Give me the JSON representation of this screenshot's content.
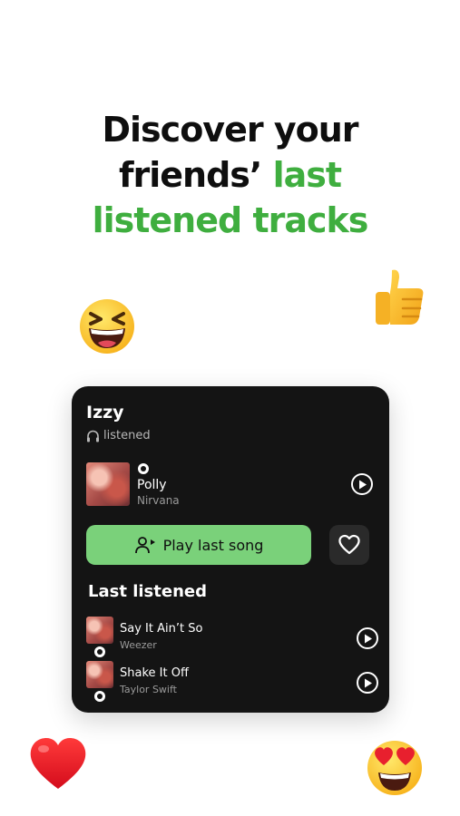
{
  "headline": {
    "line1": "Discover your",
    "line2_plain": "friends’",
    "line2_accent": "last",
    "line3_accent": "listened tracks"
  },
  "emojis": {
    "top_left": "grinning-squinting-face",
    "top_right": "thumbs-up",
    "bottom_left": "red-heart",
    "bottom_right": "heart-eyes-face"
  },
  "card": {
    "friend_name": "Izzy",
    "status": "listened",
    "current_track": {
      "title": "Polly",
      "artist": "Nirvana"
    },
    "cta_label": "Play last song",
    "section_title": "Last listened",
    "history": [
      {
        "title": "Say It Ain’t So",
        "artist": "Weezer"
      },
      {
        "title": "Shake It Off",
        "artist": "Taylor Swift"
      }
    ]
  },
  "colors": {
    "accent_green": "#3fae3f",
    "button_green": "#7ad17a",
    "card_bg": "#141414"
  }
}
